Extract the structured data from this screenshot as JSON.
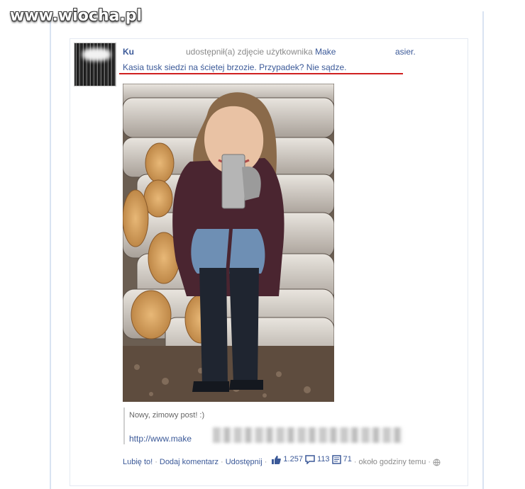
{
  "watermark": "www.wiocha.pl",
  "post": {
    "author": "Ku",
    "shared_text": "udostępnił(a) zdjęcie użytkownika",
    "owner_first": "Make",
    "owner_tail": "asier.",
    "caption": "Kasia tusk siedzi na ściętej brzozie. Przypadek? Nie sądze.",
    "quote": "Nowy, zimowy post! :)",
    "link": "http://www.make"
  },
  "actions": {
    "like": "Lubię to!",
    "comment": "Dodaj komentarz",
    "share": "Udostępnij",
    "likes_count": "1.257",
    "comments_count": "113",
    "shares_count": "71",
    "time": "około godziny temu"
  },
  "colors": {
    "link": "#3b5998",
    "muted": "#8a8a8a",
    "highlight_underline": "#d02020",
    "frame": "#dde6f3"
  }
}
